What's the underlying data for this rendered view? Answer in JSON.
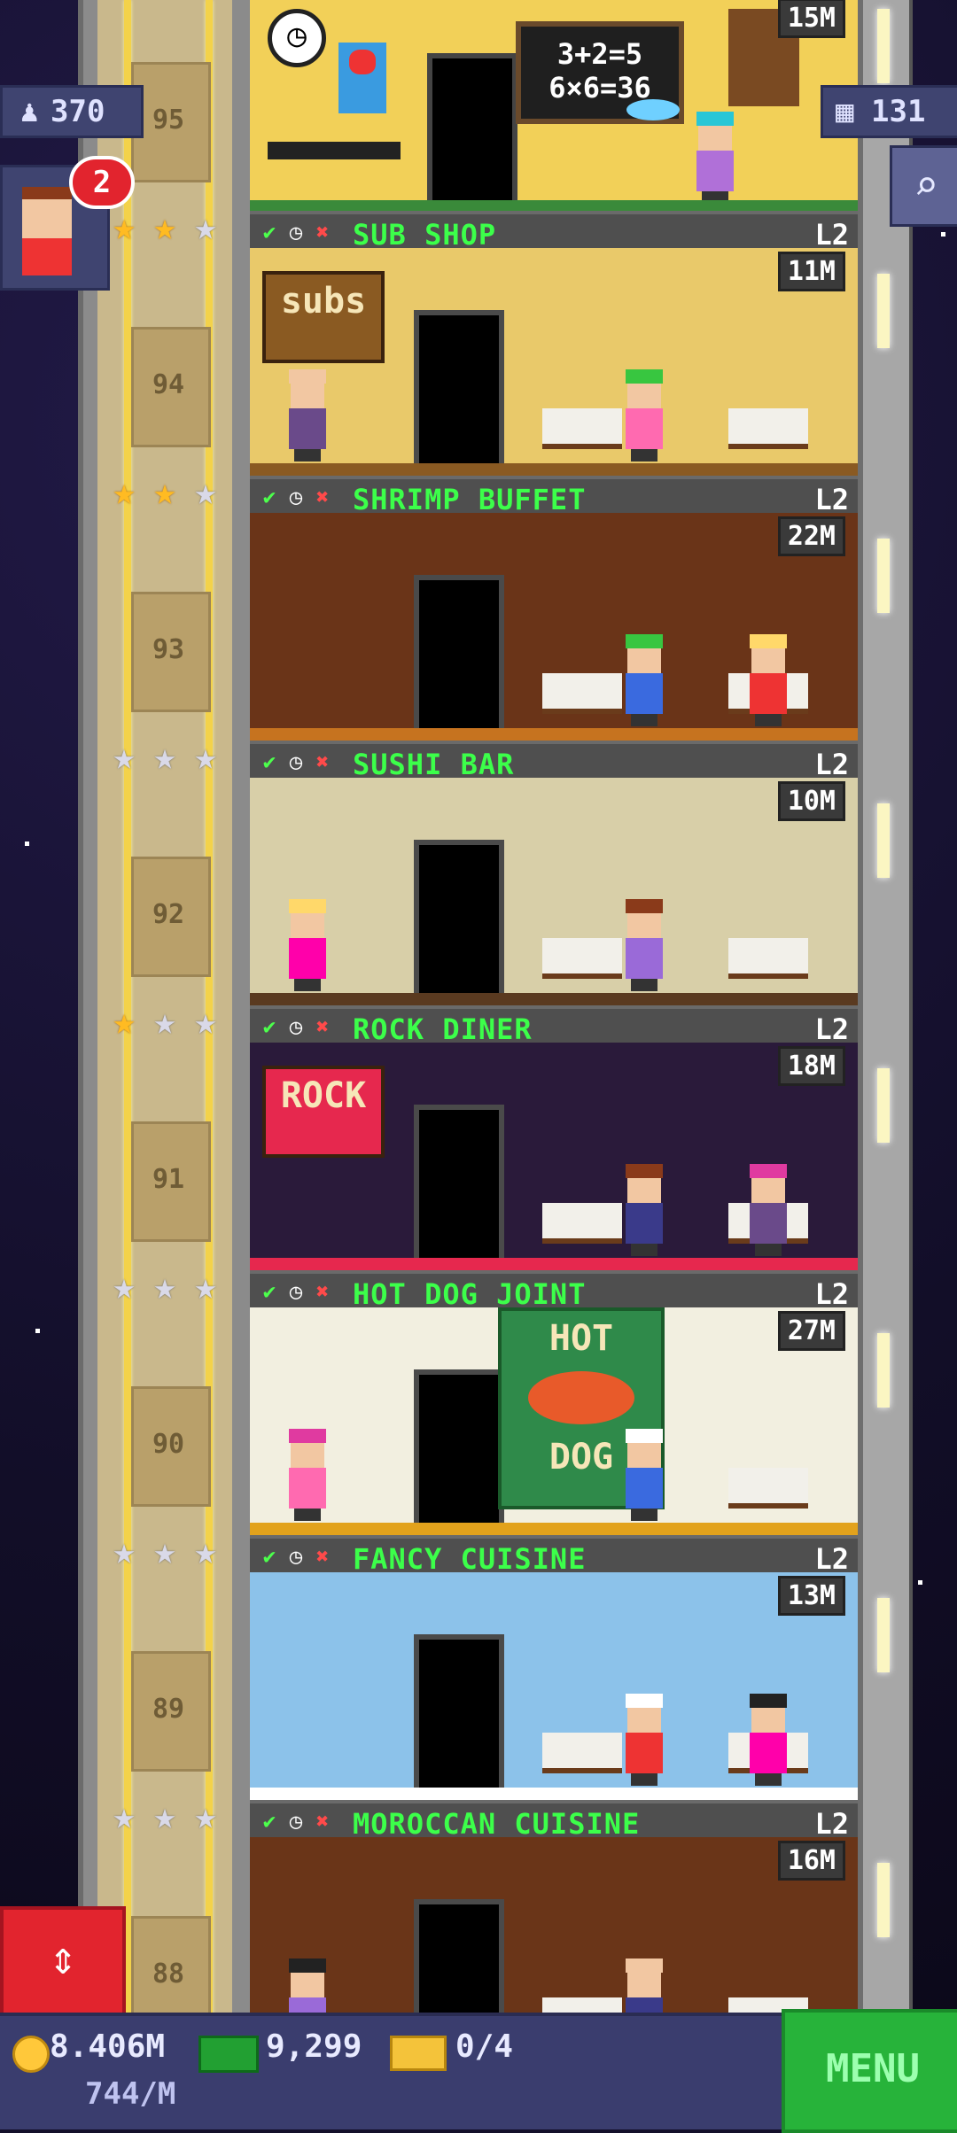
{
  "hud": {
    "residents": "370",
    "floors": "131",
    "notification_count": "2"
  },
  "colors": {
    "banner_text": "#3cff4a",
    "gold_star": "#ffbb22",
    "silver_star": "#d9d9e8",
    "menu_green": "#27b33a",
    "elevator_red": "#e2242e"
  },
  "top_floor": {
    "income": "15M",
    "chalkboard_line1": "3+2=5",
    "chalkboard_line2": "6×6=36"
  },
  "shaft_numbers": [
    "95",
    "94",
    "93",
    "92",
    "91",
    "90",
    "89",
    "88"
  ],
  "floors": [
    {
      "name": "SUB SHOP",
      "level": "L2",
      "income": "11M",
      "stars_gold": 2,
      "stars_total": 3,
      "sign_text": "subs"
    },
    {
      "name": "SHRIMP BUFFET",
      "level": "L2",
      "income": "22M",
      "stars_gold": 2,
      "stars_total": 3
    },
    {
      "name": "SUSHI BAR",
      "level": "L2",
      "income": "10M",
      "stars_gold": 0,
      "stars_total": 3
    },
    {
      "name": "ROCK DINER",
      "level": "L2",
      "income": "18M",
      "stars_gold": 1,
      "stars_total": 3,
      "sign_text": "ROCK"
    },
    {
      "name": "HOT DOG JOINT",
      "level": "L2",
      "income": "27M",
      "stars_gold": 0,
      "stars_total": 3,
      "sign_text_top": "HOT",
      "sign_text_bottom": "DOG"
    },
    {
      "name": "FANCY CUISINE",
      "level": "L2",
      "income": "13M",
      "stars_gold": 0,
      "stars_total": 3
    },
    {
      "name": "MOROCCAN CUISINE",
      "level": "L2",
      "income": "16M",
      "stars_gold": 0,
      "stars_total": 3
    }
  ],
  "bottom_bar": {
    "coins": "8.406M",
    "coins_rate": "744/M",
    "bux": "9,299",
    "tickets": "0/4",
    "menu_label": "MENU"
  },
  "icons": {
    "residents": "person-icon",
    "floors": "building-icon",
    "search": "magnifier-icon",
    "elevator": "up-down-arrows-icon",
    "coin": "coin-icon",
    "bux": "bux-icon",
    "ticket": "ticket-icon"
  }
}
